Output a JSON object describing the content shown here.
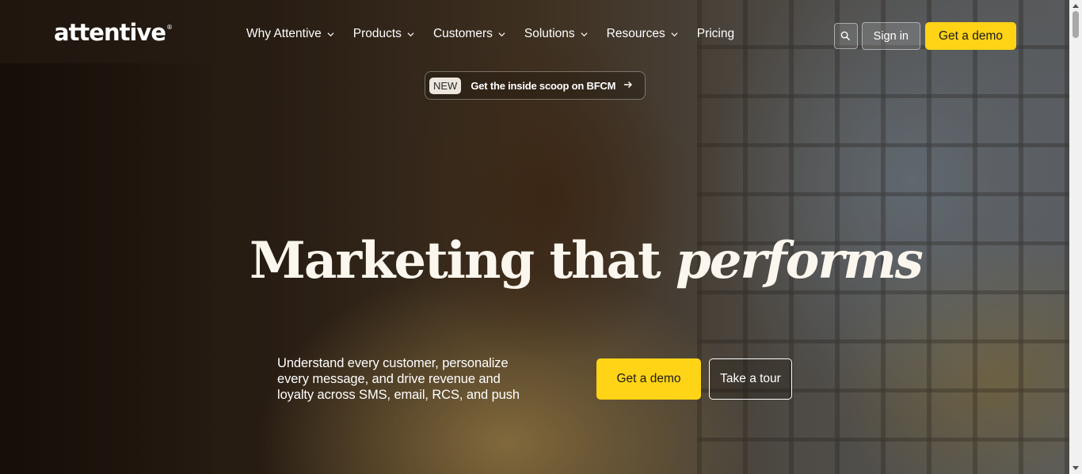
{
  "header": {
    "logo": "attentive",
    "logo_mark": "®",
    "nav": [
      {
        "label": "Why Attentive",
        "has_dropdown": true
      },
      {
        "label": "Products",
        "has_dropdown": true
      },
      {
        "label": "Customers",
        "has_dropdown": true
      },
      {
        "label": "Solutions",
        "has_dropdown": true
      },
      {
        "label": "Resources",
        "has_dropdown": true
      },
      {
        "label": "Pricing",
        "has_dropdown": false
      }
    ],
    "search_icon": "search-icon",
    "signin_label": "Sign in",
    "demo_label": "Get a demo"
  },
  "promo": {
    "badge": "NEW",
    "text": "Get the inside scoop on BFCM",
    "arrow": "→"
  },
  "hero": {
    "headline_plain": "Marketing that ",
    "headline_italic": "performs",
    "subtext": "Understand every customer, personalize every message, and drive revenue and loyalty across SMS, email, RCS, and push",
    "cta_primary": "Get a demo",
    "cta_secondary": "Take a tour"
  },
  "colors": {
    "accent": "#ffd416",
    "headline": "#fbf6ee"
  }
}
